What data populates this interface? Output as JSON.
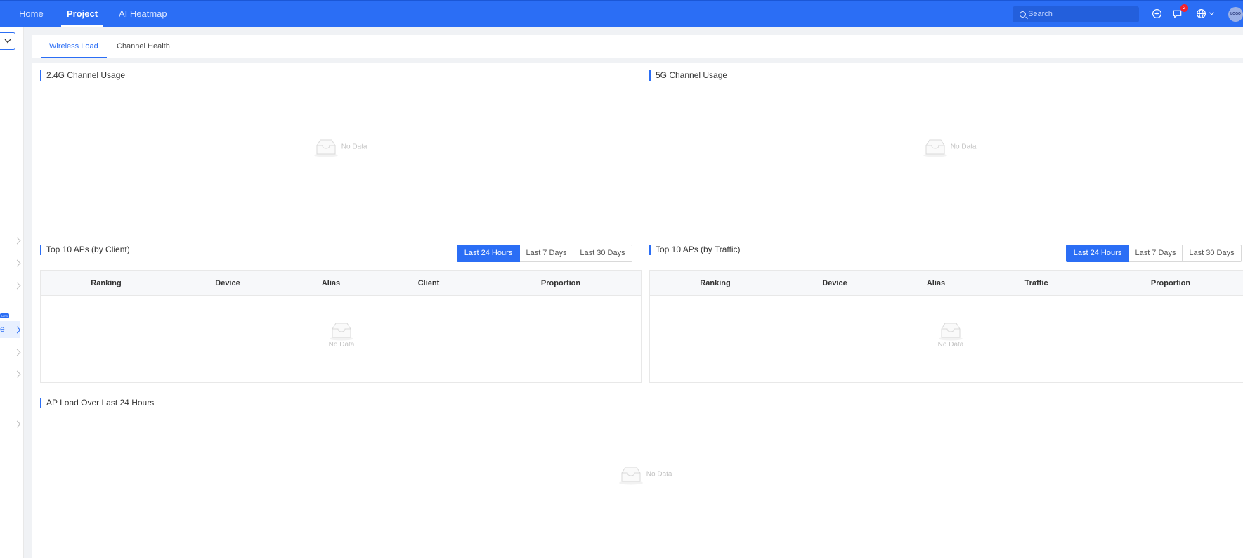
{
  "nav": {
    "home": "Home",
    "project": "Project",
    "ai_heatmap": "AI Heatmap",
    "search_placeholder": "Search",
    "notification_count": "2",
    "avatar_text": "LOGO"
  },
  "sidebar": {
    "active_item_text": "e",
    "active_item_tag": "NEW"
  },
  "tabs": {
    "wireless_load": "Wireless Load",
    "channel_health": "Channel Health"
  },
  "sections": {
    "channel_24g": {
      "title": "2.4G Channel Usage",
      "empty": "No Data"
    },
    "channel_5g": {
      "title": "5G Channel Usage",
      "empty": "No Data"
    },
    "top_client": {
      "title": "Top 10 APs (by Client)",
      "ranges": [
        "Last 24 Hours",
        "Last 7 Days",
        "Last 30 Days"
      ],
      "columns": [
        "Ranking",
        "Device",
        "Alias",
        "Client",
        "Proportion"
      ],
      "empty": "No Data"
    },
    "top_traffic": {
      "title": "Top 10 APs (by Traffic)",
      "ranges": [
        "Last 24 Hours",
        "Last 7 Days",
        "Last 30 Days"
      ],
      "columns": [
        "Ranking",
        "Device",
        "Alias",
        "Traffic",
        "Proportion"
      ],
      "empty": "No Data"
    },
    "ap_load": {
      "title": "AP Load Over Last 24 Hours",
      "empty": "No Data"
    }
  },
  "colors": {
    "primary": "#2b6ef5",
    "badge": "#f5222d"
  },
  "icons": [
    "search-icon",
    "plus-circle-icon",
    "message-icon",
    "globe-icon",
    "chevron-down-icon",
    "chevron-right-icon",
    "empty-inbox-icon"
  ]
}
